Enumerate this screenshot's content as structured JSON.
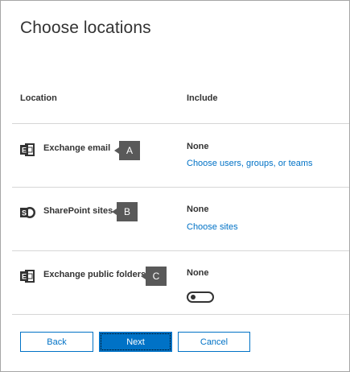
{
  "dialog": {
    "title": "Choose locations"
  },
  "columns": {
    "location": "Location",
    "include": "Include"
  },
  "rows": [
    {
      "icon": "exchange-icon",
      "name": "Exchange email",
      "callout": "A",
      "include_value": "None",
      "include_link": "Choose users, groups, or teams"
    },
    {
      "icon": "sharepoint-icon",
      "name": "SharePoint sites",
      "callout": "B",
      "include_value": "None",
      "include_link": "Choose sites"
    },
    {
      "icon": "exchange-icon",
      "name": "Exchange public folders",
      "callout": "C",
      "include_value": "None",
      "toggle_on": false
    }
  ],
  "buttons": {
    "back": "Back",
    "next": "Next",
    "cancel": "Cancel"
  },
  "colors": {
    "accent": "#0072c6",
    "callout": "#595959",
    "text": "#333333",
    "divider": "#d6d6d6"
  }
}
